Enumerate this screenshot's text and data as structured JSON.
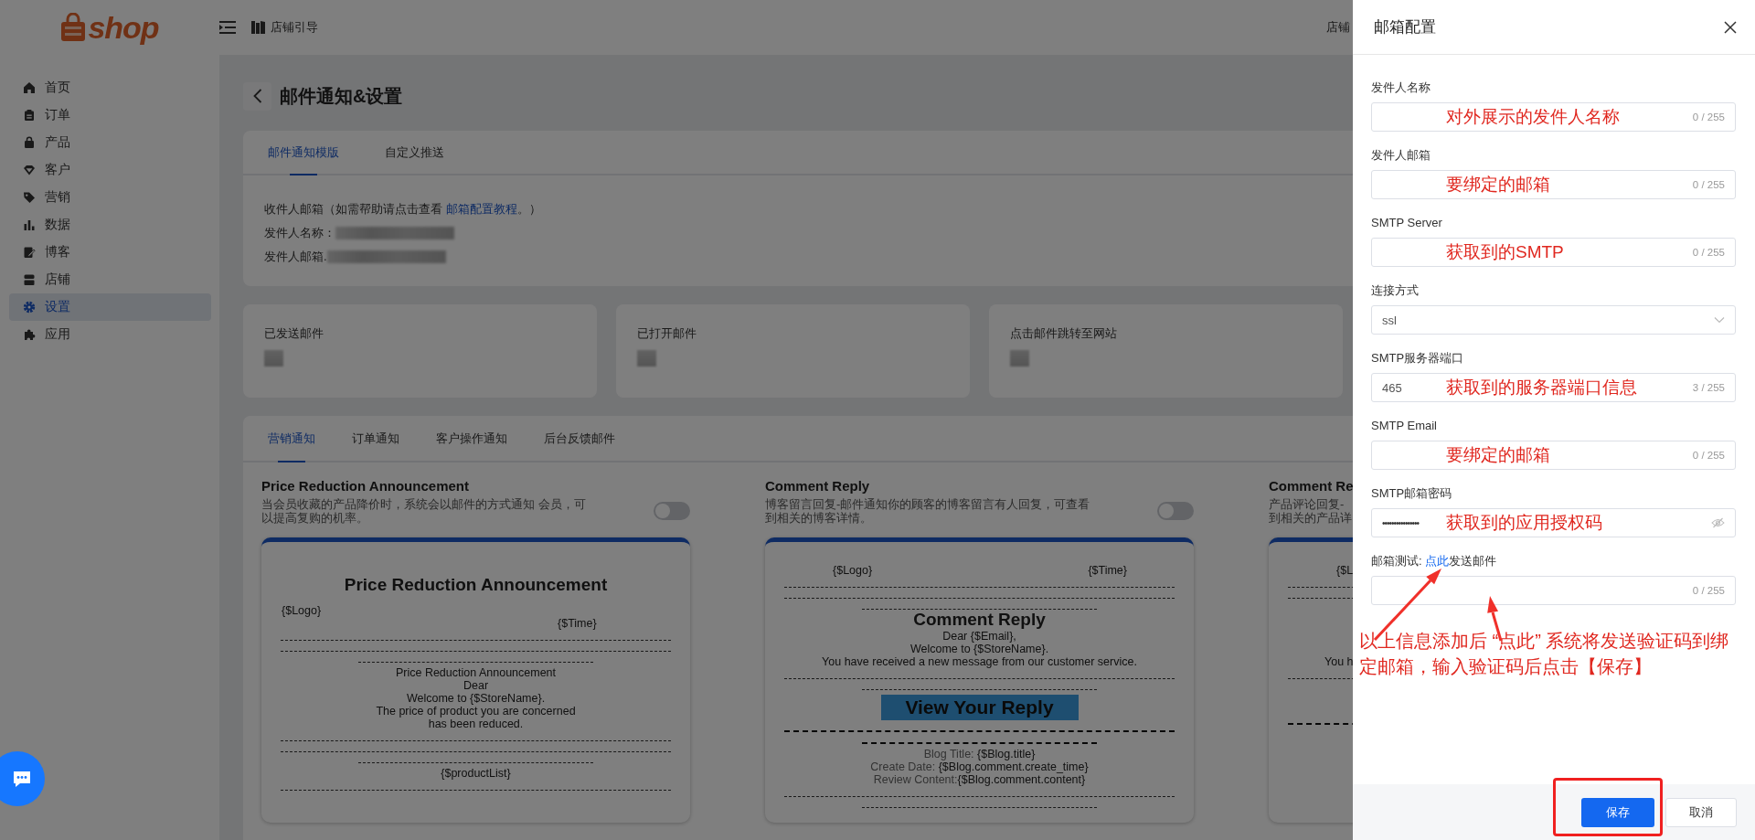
{
  "header": {
    "logo": "shop",
    "guide": "店铺引导",
    "right_link": "店铺"
  },
  "sidebar": {
    "items": [
      {
        "label": "首页",
        "selected": false
      },
      {
        "label": "订单",
        "selected": false
      },
      {
        "label": "产品",
        "selected": false
      },
      {
        "label": "客户",
        "selected": false
      },
      {
        "label": "营销",
        "selected": false
      },
      {
        "label": "数据",
        "selected": false
      },
      {
        "label": "博客",
        "selected": false
      },
      {
        "label": "店铺",
        "selected": false
      },
      {
        "label": "设置",
        "selected": true
      },
      {
        "label": "应用",
        "selected": false
      }
    ]
  },
  "page": {
    "title": "邮件通知&设置"
  },
  "top_tabs": [
    {
      "label": "邮件通知模版",
      "selected": true
    },
    {
      "label": "自定义推送",
      "selected": false
    }
  ],
  "info": {
    "recipient": {
      "before": "收件人邮箱（如需帮助请点击查看 ",
      "link": "邮箱配置教程",
      "after": "。）"
    },
    "sender_name_label": "发件人名称：",
    "sender_email_label": "发件人邮箱."
  },
  "stats": [
    {
      "label": "已发送邮件"
    },
    {
      "label": "已打开邮件"
    },
    {
      "label": "点击邮件跳转至网站"
    }
  ],
  "notice_tabs": [
    {
      "label": "营销通知",
      "selected": true
    },
    {
      "label": "订单通知",
      "selected": false
    },
    {
      "label": "客户操作通知",
      "selected": false
    },
    {
      "label": "后台反馈邮件",
      "selected": false
    }
  ],
  "templates": [
    {
      "title": "Price Reduction Announcement",
      "description": [
        "当会员收藏的产品降价时，系统会以邮件的方式通知 会员，可",
        "以提高复购的机率。"
      ],
      "enabled": false,
      "preview": {
        "kind": "announcement",
        "heading": "Price Reduction Announcement",
        "logo": "{$Logo}",
        "time": "{$Time}",
        "lines": [
          "Price Reduction Announcement",
          "Dear",
          "Welcome to {$StoreName}.",
          "The price of product you are concerned",
          "has been reduced."
        ],
        "footer": "{$productList}"
      }
    },
    {
      "title": "Comment Reply",
      "description": [
        "博客留言回复-邮件通知你的顾客的博客留言有人回复，可查看",
        "到相关的博客详情。"
      ],
      "enabled": false,
      "preview": {
        "kind": "reply",
        "logo": "{$Logo}",
        "time": "{$Time}",
        "heading": "Comment Reply",
        "lines": [
          "Dear {$Email},",
          "Welcome to {$StoreName}.",
          "You have received a new message from our customer service."
        ],
        "button": "View Your Reply",
        "fields": [
          {
            "label": "Blog Title: ",
            "value": "{$Blog.title}"
          },
          {
            "label": "Create Date: ",
            "value": "{$Blog.comment.create_time}"
          },
          {
            "label": "Review Content:",
            "value": "{$Blog.comment.content}"
          }
        ]
      }
    },
    {
      "title": "Comment Re",
      "description": [
        "产品评论回复-",
        "到相关的产品详"
      ],
      "preview": {
        "kind": "cut",
        "logo": "{$L",
        "lines": [
          "You h"
        ]
      }
    }
  ],
  "drawer": {
    "title": "邮箱配置",
    "fields": [
      {
        "kind": "text",
        "label": "发件人名称",
        "annotation": "对外展示的发件人名称",
        "counter": "0 / 255"
      },
      {
        "kind": "text",
        "label": "发件人邮箱",
        "annotation": "要绑定的邮箱",
        "counter": "0 / 255"
      },
      {
        "kind": "text",
        "label": "SMTP Server",
        "annotation": "获取到的SMTP",
        "counter": "0 / 255"
      },
      {
        "kind": "select",
        "label": "连接方式",
        "value": "ssl"
      },
      {
        "kind": "text",
        "label": "SMTP服务器端口",
        "value": "465",
        "annotation": "获取到的服务器端口信息",
        "counter": "3 / 255"
      },
      {
        "kind": "text",
        "label": "SMTP Email",
        "annotation": "要绑定的邮箱",
        "counter": "0 / 255"
      },
      {
        "kind": "password",
        "label": "SMTP邮箱密码",
        "value": "••••••••••••••••",
        "annotation": "获取到的应用授权码"
      }
    ],
    "test": {
      "label": "邮箱测试: ",
      "link": "点此",
      "after": "发送邮件",
      "counter": "0 / 255"
    },
    "note": "以上信息添加后 “点此” 系统将发送验证码到绑定邮箱，输入验证码后点击【保存】",
    "save": "保存",
    "cancel": "取消"
  }
}
